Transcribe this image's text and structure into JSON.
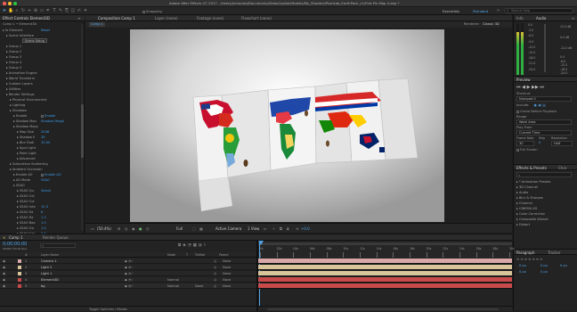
{
  "window": {
    "title": "Adobe After Effects CC 2017 - /Users/jmiranda/Documents/VideoCopilot/Models/My_Shaders/PixelLab_EarthPack_v1/Flat-Pin Map 4.aep *"
  },
  "toolbar": {
    "snapping": "Snapping",
    "workspaces": [
      "Essentials",
      "Standard"
    ],
    "search_placeholder": "Search Help"
  },
  "left_panel": {
    "tab": "Effect Controls Element3D",
    "subheader": "Comp 1 • Element3D",
    "rows": [
      {
        "indent": 0,
        "text": "fx Element",
        "value": "Reset"
      },
      {
        "indent": 1,
        "text": "Scene Interface",
        "value": ""
      },
      {
        "indent": 2,
        "button": "Scene Setup"
      },
      {
        "indent": 1,
        "text": "Group 1",
        "value": ""
      },
      {
        "indent": 1,
        "text": "Group 2",
        "value": ""
      },
      {
        "indent": 1,
        "text": "Group 3",
        "value": ""
      },
      {
        "indent": 1,
        "text": "Group 4",
        "value": ""
      },
      {
        "indent": 1,
        "text": "Group 5",
        "value": ""
      },
      {
        "indent": 1,
        "text": "Animation Engine",
        "value": ""
      },
      {
        "indent": 1,
        "text": "World Transform",
        "value": ""
      },
      {
        "indent": 1,
        "text": "Custom Layers",
        "value": ""
      },
      {
        "indent": 1,
        "text": "Utilities",
        "value": ""
      },
      {
        "indent": 1,
        "text": "Render Settings",
        "value": ""
      },
      {
        "indent": 2,
        "text": "Physical Environment",
        "value": ""
      },
      {
        "indent": 2,
        "text": "Lighting",
        "value": ""
      },
      {
        "indent": 2,
        "text": "Shadows",
        "value": ""
      },
      {
        "indent": 3,
        "text": "Enable",
        "value": "Enable",
        "check": true
      },
      {
        "indent": 3,
        "text": "Shadow Mod",
        "value": "Shadow Mappi"
      },
      {
        "indent": 3,
        "text": "Shadow Maps",
        "value": ""
      },
      {
        "indent": 4,
        "text": "Map Size",
        "value": "2048"
      },
      {
        "indent": 4,
        "text": "Shadow Il",
        "value": "35"
      },
      {
        "indent": 4,
        "text": "Blur Radi",
        "value": "10.00"
      },
      {
        "indent": 4,
        "text": "Spot Light",
        "value": ""
      },
      {
        "indent": 4,
        "text": "Point Light",
        "value": ""
      },
      {
        "indent": 4,
        "text": "Advanced",
        "value": ""
      },
      {
        "indent": 2,
        "text": "Subsurface Scattering",
        "value": ""
      },
      {
        "indent": 2,
        "text": "Ambient Occlusion",
        "value": ""
      },
      {
        "indent": 3,
        "text": "Enable AO",
        "value": "Enable AO",
        "check": true
      },
      {
        "indent": 3,
        "text": "AO Mode",
        "value": "SSAO"
      },
      {
        "indent": 3,
        "text": "SSAO",
        "value": ""
      },
      {
        "indent": 4,
        "text": "SSAO Qu",
        "value": "Select"
      },
      {
        "indent": 4,
        "text": "SSAO Col",
        "value": ""
      },
      {
        "indent": 4,
        "text": "SSAO Col",
        "value": ""
      },
      {
        "indent": 4,
        "text": "SSAO Inte",
        "value": "12.3"
      },
      {
        "indent": 4,
        "text": "SSAO Sa",
        "value": "6"
      },
      {
        "indent": 4,
        "text": "SSAO Ra",
        "value": "1.3"
      },
      {
        "indent": 4,
        "text": "SSAO Bas",
        "value": "1.0"
      },
      {
        "indent": 4,
        "text": "SSAO Ga",
        "value": "1.0"
      },
      {
        "indent": 4,
        "text": "SSAO Gai",
        "value": "3.0"
      }
    ]
  },
  "comp_panel": {
    "tabs": [
      "Composition Comp 1",
      "Layer (none)",
      "Footage (none)",
      "Flowchart (none)"
    ],
    "comp_tab": "Comp 1",
    "renderer_label": "Renderer:",
    "renderer": "Classic 3D"
  },
  "viewer_bar": {
    "zoom": "(50.4%)",
    "resolution": "Full",
    "camera": "Active Camera",
    "views": "1 View",
    "exposure": "+0.0"
  },
  "right_panel": {
    "tabs": [
      "Info",
      "Audio"
    ],
    "audio_scale_left": [
      "0.0",
      "-6.0",
      "-12.0",
      "-18.0",
      "-24.0"
    ],
    "audio_db_right": [
      "12.0 dB",
      "0.0 dB",
      "-12.0 dB"
    ],
    "audio_scale_mid": [
      "0.0",
      "-3.0",
      "-6.0",
      "-9.0",
      "-12.0",
      "-15.0",
      "-18.0",
      "-21.0",
      "-24.0"
    ],
    "preview_tab": "Preview",
    "shortcut_label": "Shortcut",
    "shortcut_value": "Numpad 0",
    "include_label": "Include:",
    "cache_label": "Cache Before Playback",
    "range_label": "Range",
    "range_value": "Work Area",
    "play_from_label": "Play From",
    "play_from_value": "Current Time",
    "frame_rate_label": "Frame Rate",
    "skip_label": "Skip",
    "resolution_label": "Resolution",
    "frame_rate_value": "30",
    "skip_value": "0",
    "resolution_value": "Half",
    "fullscreen_label": "Full Screen",
    "effects_tab": "Effects & Presets",
    "char_tab": "Char",
    "presets": [
      "* Animation Presets",
      "3D Channel",
      "Audio",
      "Blur & Sharpen",
      "Channel",
      "CINEMA 4D",
      "Color Correction",
      "Composite Wizard",
      "Distort"
    ],
    "paragraph_tab": "Paragraph",
    "tracker_tab": "Tracker",
    "para_values": [
      "0 px",
      "0 px",
      "0 px",
      "0 px",
      "0 px"
    ]
  },
  "timeline": {
    "tabs": [
      "Comp 1",
      "Render Queue"
    ],
    "timecode": "0;00;00;00",
    "fps_note": "00000 (30.00 fps)",
    "col_headers": [
      "#",
      "Layer Name",
      "Mode",
      "T",
      "TrkMat",
      "Parent"
    ],
    "layers": [
      {
        "num": "1",
        "name": "Camera 1",
        "color": "#d8a7a7",
        "mode": "",
        "trkmat": "",
        "parent": "None"
      },
      {
        "num": "2",
        "name": "Light 2",
        "color": "#d8c69a",
        "mode": "",
        "trkmat": "",
        "parent": "None"
      },
      {
        "num": "3",
        "name": "Light 1",
        "color": "#d8c69a",
        "mode": "",
        "trkmat": "",
        "parent": "None"
      },
      {
        "num": "4",
        "name": "Element3D",
        "color": "#c94a4a",
        "mode": "Normal",
        "trkmat": "",
        "parent": "None"
      },
      {
        "num": "5",
        "name": "bg",
        "color": "#c94a4a",
        "mode": "Normal",
        "trkmat": "None",
        "parent": "None"
      }
    ],
    "ruler": [
      "0s",
      "02s",
      "04s",
      "06s",
      "08s",
      "10s",
      "12s",
      "14s",
      "16s",
      "18s",
      "20s",
      "22s",
      "24s",
      "26s",
      "28s",
      "30s"
    ],
    "toggle_label": "Toggle Switches / Modes"
  }
}
